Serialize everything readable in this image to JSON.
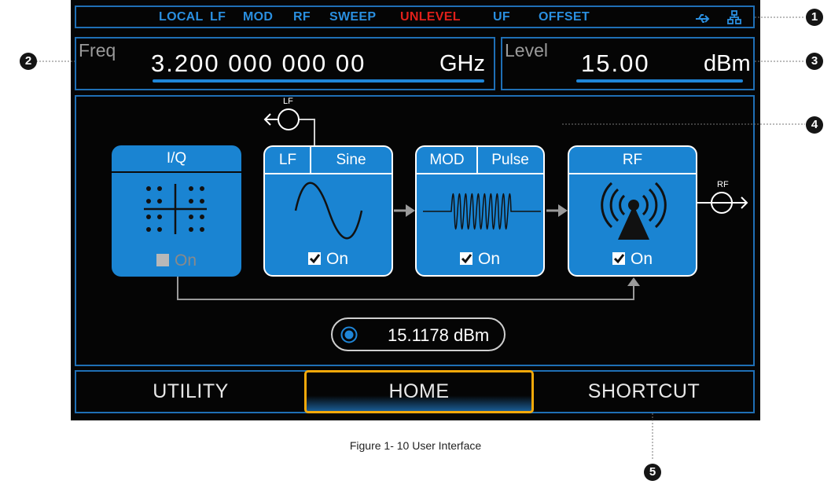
{
  "status_bar": {
    "items": [
      "LOCAL",
      "LF",
      "MOD",
      "RF",
      "SWEEP",
      "UNLEVEL",
      "UF",
      "OFFSET"
    ],
    "usb_icon": "usb-icon",
    "network_icon": "network-icon",
    "warning_color": "#e0201a",
    "text_color": "#2a8fe0"
  },
  "freq": {
    "label": "Freq",
    "value": "3.200 000 000 00",
    "unit": "GHz"
  },
  "level": {
    "label": "Level",
    "value": "15.00",
    "unit": "dBm"
  },
  "blocks": {
    "iq": {
      "title": "I/Q",
      "on_label": "On",
      "checked": false
    },
    "lf": {
      "title": "LF",
      "subtitle": "Sine",
      "on_label": "On",
      "checked": true,
      "output_label": "LF"
    },
    "mod": {
      "title": "MOD",
      "subtitle": "Pulse",
      "on_label": "On",
      "checked": true
    },
    "rf": {
      "title": "RF",
      "on_label": "On",
      "checked": true,
      "output_label": "RF"
    }
  },
  "readout": {
    "value": "15.1178 dBm"
  },
  "softkeys": {
    "utility": "UTILITY",
    "home": "HOME",
    "shortcut": "SHORTCUT",
    "active": "HOME"
  },
  "callouts": [
    "1",
    "2",
    "3",
    "4",
    "5"
  ],
  "caption": "Figure 1- 10 User Interface",
  "colors": {
    "accent_blue": "#1a84d2",
    "active_key": "#f5a90a",
    "background": "#050505"
  }
}
